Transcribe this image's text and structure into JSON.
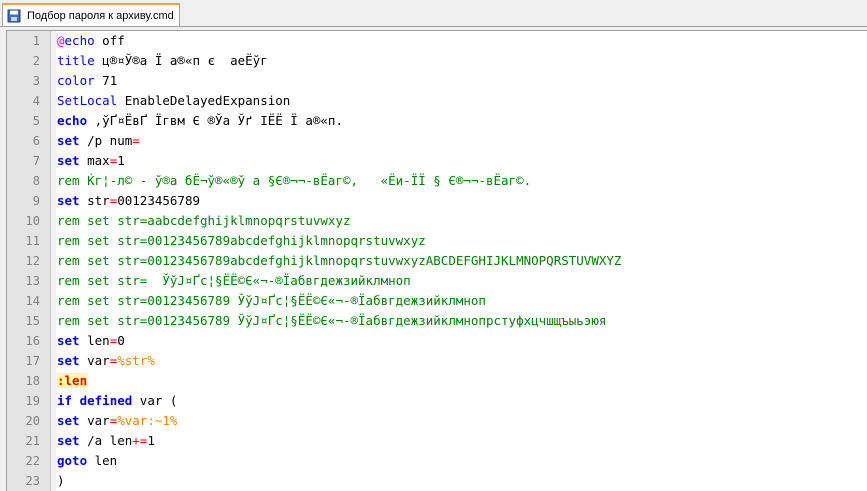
{
  "tab": {
    "label": "Подбор пароля к архиву.cmd",
    "icon": "save-disk-icon"
  },
  "lines": [
    {
      "n": "1",
      "parts": [
        {
          "c": "at",
          "t": "@"
        },
        {
          "c": "kw2",
          "t": "echo"
        },
        {
          "c": "txt",
          "t": " off"
        }
      ]
    },
    {
      "n": "2",
      "parts": [
        {
          "c": "kw2",
          "t": "title"
        },
        {
          "c": "txt",
          "t": " ц®¤Ў®а Ї а®«п є  аеЁўг"
        }
      ]
    },
    {
      "n": "3",
      "parts": [
        {
          "c": "kw2",
          "t": "color"
        },
        {
          "c": "txt",
          "t": " 71"
        }
      ]
    },
    {
      "n": "4",
      "parts": [
        {
          "c": "kw2",
          "t": "SetLocal"
        },
        {
          "c": "txt",
          "t": " EnableDelayedExpansion"
        }
      ]
    },
    {
      "n": "5",
      "parts": [
        {
          "c": "kw",
          "t": "echo"
        },
        {
          "c": "txt",
          "t": " ,ўҐ¤ЁвҐ Їгвм Є ®Ўа Ўґ ІЁЁ Ї а®«п."
        }
      ]
    },
    {
      "n": "6",
      "parts": [
        {
          "c": "kw",
          "t": "set"
        },
        {
          "c": "txt",
          "t": " /p num"
        },
        {
          "c": "op",
          "t": "="
        }
      ]
    },
    {
      "n": "7",
      "parts": [
        {
          "c": "kw",
          "t": "set"
        },
        {
          "c": "txt",
          "t": " max"
        },
        {
          "c": "op",
          "t": "="
        },
        {
          "c": "txt",
          "t": "1"
        }
      ]
    },
    {
      "n": "8",
      "parts": [
        {
          "c": "rem",
          "t": "rem Ќг¦-л© - ў®а бЁ¬ў®«®ў а §Є®¬¬-вЁаг©,   «Ёи-ЇЇ § Є®¬¬-вЁаг©."
        }
      ]
    },
    {
      "n": "9",
      "parts": [
        {
          "c": "kw",
          "t": "set"
        },
        {
          "c": "txt",
          "t": " str"
        },
        {
          "c": "op",
          "t": "="
        },
        {
          "c": "txt",
          "t": "00123456789"
        }
      ]
    },
    {
      "n": "10",
      "parts": [
        {
          "c": "rem",
          "t": "rem set str=aabcdefghijklmnopqrstuvwxyz"
        }
      ]
    },
    {
      "n": "11",
      "parts": [
        {
          "c": "rem",
          "t": "rem set str=00123456789abcdefghijklmnopqrstuvwxyz"
        }
      ]
    },
    {
      "n": "12",
      "parts": [
        {
          "c": "rem",
          "t": "rem set str=00123456789abcdefghijklmnopqrstuvwxyzABCDEFGHIJKLMNOPQRSTUVWXYZ"
        }
      ]
    },
    {
      "n": "13",
      "parts": [
        {
          "c": "rem",
          "t": "rem set str=  ЎўЈ¤Ґс¦§ЁЁ©Є«¬-®Їабвгдежзийклмноп"
        }
      ]
    },
    {
      "n": "14",
      "parts": [
        {
          "c": "rem",
          "t": "rem set str=00123456789 ЎўЈ¤Ґс¦§ЁЁ©Є«¬-®Їабвгдежзийклмноп"
        }
      ]
    },
    {
      "n": "15",
      "parts": [
        {
          "c": "rem",
          "t": "rem set str=00123456789 ЎўЈ¤Ґс¦§ЁЁ©Є«¬-®Їабвгдежзийклмнопрстуфхцчшщъыьэюя"
        }
      ]
    },
    {
      "n": "16",
      "parts": [
        {
          "c": "kw",
          "t": "set"
        },
        {
          "c": "txt",
          "t": " len"
        },
        {
          "c": "op",
          "t": "="
        },
        {
          "c": "txt",
          "t": "0"
        }
      ]
    },
    {
      "n": "17",
      "parts": [
        {
          "c": "kw",
          "t": "set"
        },
        {
          "c": "txt",
          "t": " var"
        },
        {
          "c": "op",
          "t": "="
        },
        {
          "c": "var",
          "t": "%str%"
        }
      ]
    },
    {
      "n": "18",
      "parts": [
        {
          "c": "lbl",
          "t": ":len"
        }
      ]
    },
    {
      "n": "19",
      "parts": [
        {
          "c": "kw",
          "t": "if"
        },
        {
          "c": "txt",
          "t": " "
        },
        {
          "c": "kw",
          "t": "defined"
        },
        {
          "c": "txt",
          "t": " var ("
        }
      ]
    },
    {
      "n": "20",
      "parts": [
        {
          "c": "kw",
          "t": "set"
        },
        {
          "c": "txt",
          "t": " var"
        },
        {
          "c": "op",
          "t": "="
        },
        {
          "c": "var",
          "t": "%var:~1%"
        }
      ]
    },
    {
      "n": "21",
      "parts": [
        {
          "c": "kw",
          "t": "set"
        },
        {
          "c": "txt",
          "t": " /a len"
        },
        {
          "c": "op",
          "t": "+="
        },
        {
          "c": "txt",
          "t": "1"
        }
      ]
    },
    {
      "n": "22",
      "parts": [
        {
          "c": "kw",
          "t": "goto"
        },
        {
          "c": "txt",
          "t": " len"
        }
      ]
    },
    {
      "n": "23",
      "parts": [
        {
          "c": "txt",
          "t": ")"
        }
      ]
    }
  ]
}
